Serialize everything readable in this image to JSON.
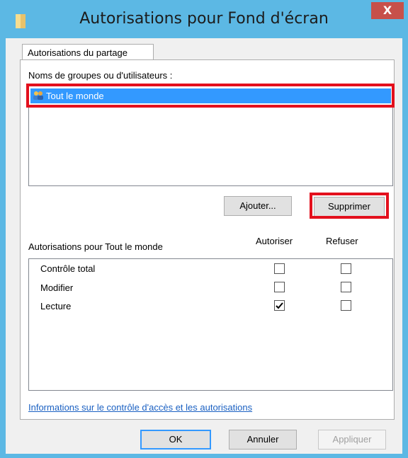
{
  "window": {
    "title": "Autorisations pour Fond d'écran",
    "close_glyph": "X"
  },
  "tab": {
    "label": "Autorisations du partage"
  },
  "groups": {
    "label": "Noms de groupes ou d'utilisateurs :",
    "items": [
      {
        "name": "Tout le monde",
        "icon": "users-icon",
        "selected": true
      }
    ]
  },
  "buttons": {
    "add": "Ajouter...",
    "remove": "Supprimer"
  },
  "permissions": {
    "label": "Autorisations pour Tout le monde",
    "col_allow": "Autoriser",
    "col_deny": "Refuser",
    "rows": [
      {
        "name": "Contrôle total",
        "allow": false,
        "deny": false
      },
      {
        "name": "Modifier",
        "allow": false,
        "deny": false
      },
      {
        "name": "Lecture",
        "allow": true,
        "deny": false
      }
    ]
  },
  "info_link": "Informations sur le contrôle d'accès et les autorisations",
  "footer": {
    "ok": "OK",
    "cancel": "Annuler",
    "apply": "Appliquer"
  },
  "colors": {
    "selection": "#3399ff",
    "highlight_box": "#e3101d",
    "link": "#1a60c2",
    "frame": "#5cb8e4"
  }
}
